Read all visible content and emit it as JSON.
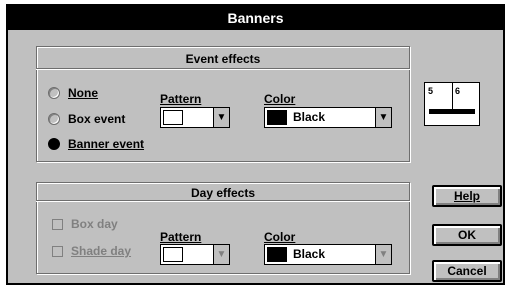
{
  "window": {
    "title": "Banners"
  },
  "event_effects": {
    "title": "Event effects",
    "options": [
      {
        "label": "None",
        "selected": false
      },
      {
        "label": "Box event",
        "selected": false
      },
      {
        "label": "Banner event",
        "selected": true
      }
    ],
    "pattern": {
      "label": "Pattern",
      "value": ""
    },
    "color": {
      "label": "Color",
      "value": "Black"
    }
  },
  "day_effects": {
    "title": "Day effects",
    "options": [
      {
        "label": "Box day",
        "enabled": false
      },
      {
        "label": "Shade day",
        "enabled": false
      }
    ],
    "pattern": {
      "label": "Pattern",
      "value": ""
    },
    "color": {
      "label": "Color",
      "value": "Black"
    }
  },
  "preview": {
    "day1": "5",
    "day2": "6"
  },
  "buttons": {
    "help": "Help",
    "ok": "OK",
    "cancel": "Cancel"
  },
  "colors": {
    "swatch_black": "#000000",
    "window_bg": "#c0c0c0"
  }
}
